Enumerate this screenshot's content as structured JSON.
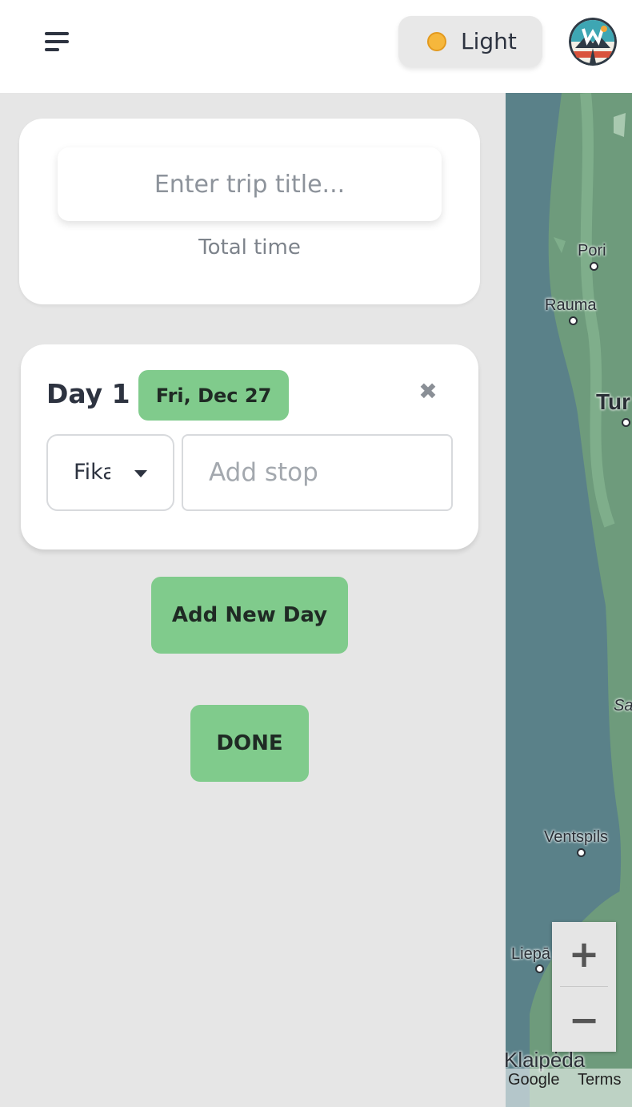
{
  "header": {
    "theme_label": "Light",
    "theme_icon": "sun-icon"
  },
  "trip": {
    "title_placeholder": "Enter trip title...",
    "title_value": "",
    "total_time_label": "Total time"
  },
  "days": [
    {
      "label": "Day 1",
      "date": "Fri, Dec 27",
      "stop_type": "Fika",
      "stop_placeholder": "Add stop"
    }
  ],
  "buttons": {
    "add_day": "Add New Day",
    "done": "DONE"
  },
  "map": {
    "places": [
      "Pori",
      "Rauma",
      "Tur",
      "Sa",
      "Ventspils",
      "Liepā",
      "Klaipėda"
    ],
    "zoom_in": "+",
    "zoom_out": "−",
    "attribution": "Google",
    "terms": "Terms"
  },
  "colors": {
    "accent_green": "#80cb8c",
    "page_bg": "#e6e6e6",
    "water": "#5a8189",
    "land": "#6e9b7c"
  }
}
